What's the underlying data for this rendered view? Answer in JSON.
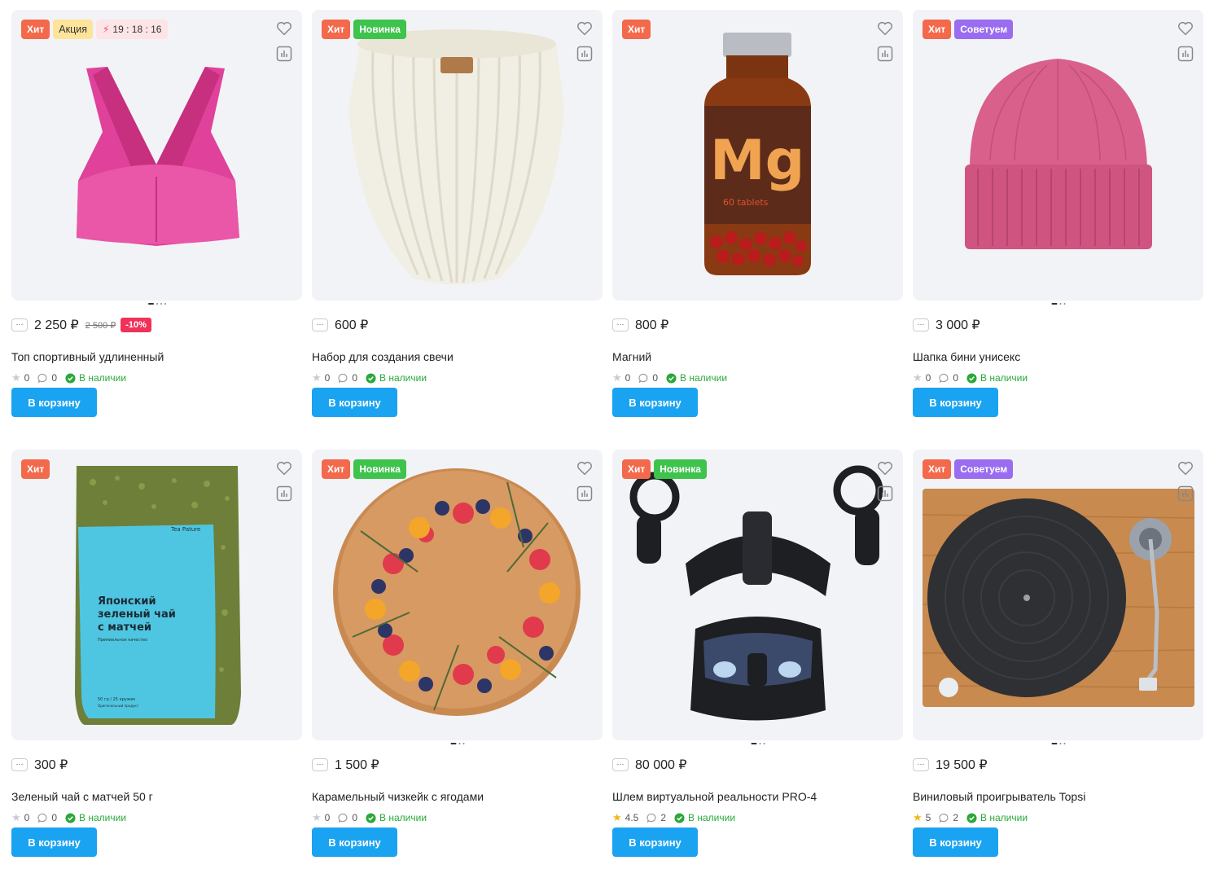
{
  "currency": "₽",
  "cart_label": "В корзину",
  "qty_label": "···",
  "availability_label": "В наличии",
  "products": [
    {
      "badges": [
        {
          "type": "hit",
          "text": "Хит"
        },
        {
          "type": "akcia",
          "text": "Акция"
        }
      ],
      "timer": "19 : 18 : 16",
      "price": "2 250 ₽",
      "old_price": "2 500 ₽",
      "discount": "-10%",
      "title": "Топ спортивный удлиненный",
      "rating": "0",
      "reviews": "0",
      "rated": false,
      "image": "sports-bra-image"
    },
    {
      "badges": [
        {
          "type": "hit",
          "text": "Хит"
        },
        {
          "type": "novinka",
          "text": "Новинка"
        }
      ],
      "price": "600 ₽",
      "title": "Набор для создания свечи",
      "rating": "0",
      "reviews": "0",
      "rated": false,
      "image": "candle-image"
    },
    {
      "badges": [
        {
          "type": "hit",
          "text": "Хит"
        }
      ],
      "price": "800 ₽",
      "title": "Магний",
      "rating": "0",
      "reviews": "0",
      "rated": false,
      "image": "magnesium-bottle-image",
      "label_big": "Mg",
      "label_small": "60 tablets"
    },
    {
      "badges": [
        {
          "type": "hit",
          "text": "Хит"
        },
        {
          "type": "sovetuem",
          "text": "Советуем"
        }
      ],
      "price": "3 000 ₽",
      "title": "Шапка бини унисекс",
      "rating": "0",
      "reviews": "0",
      "rated": false,
      "image": "beanie-hat-image"
    },
    {
      "badges": [
        {
          "type": "hit",
          "text": "Хит"
        }
      ],
      "price": "300 ₽",
      "title": "Зеленый чай с матчей 50 г",
      "rating": "0",
      "reviews": "0",
      "rated": false,
      "image": "green-tea-pack-image",
      "pack_brand": "Tea Pature",
      "pack_line1": "Японский",
      "pack_line2": "зеленый чай",
      "pack_line3": "с матчей",
      "pack_sub": "Премиальное качество",
      "pack_weight": "50 гр / 25 кружек",
      "pack_foot": "Оригинальный продукт"
    },
    {
      "badges": [
        {
          "type": "hit",
          "text": "Хит"
        },
        {
          "type": "novinka",
          "text": "Новинка"
        }
      ],
      "price": "1 500 ₽",
      "title": "Карамельный чизкейк с ягодами",
      "rating": "0",
      "reviews": "0",
      "rated": false,
      "image": "cheesecake-image"
    },
    {
      "badges": [
        {
          "type": "hit",
          "text": "Хит"
        },
        {
          "type": "novinka",
          "text": "Новинка"
        }
      ],
      "price": "80 000 ₽",
      "title": "Шлем виртуальной реальности PRO-4",
      "rating": "4.5",
      "reviews": "2",
      "rated": true,
      "image": "vr-headset-image"
    },
    {
      "badges": [
        {
          "type": "hit",
          "text": "Хит"
        },
        {
          "type": "sovetuem",
          "text": "Советуем"
        }
      ],
      "price": "19 500 ₽",
      "title": "Виниловый проигрыватель Topsi",
      "rating": "5",
      "reviews": "2",
      "rated": true,
      "image": "turntable-image"
    }
  ],
  "colors": {
    "hit": "#f3694b",
    "akcia": "#fde49a",
    "novinka": "#3ec34d",
    "sovetuem": "#9a6cf0",
    "cart_button": "#1aa3f1",
    "in_stock": "#2aa83a",
    "discount": "#f0325a"
  }
}
